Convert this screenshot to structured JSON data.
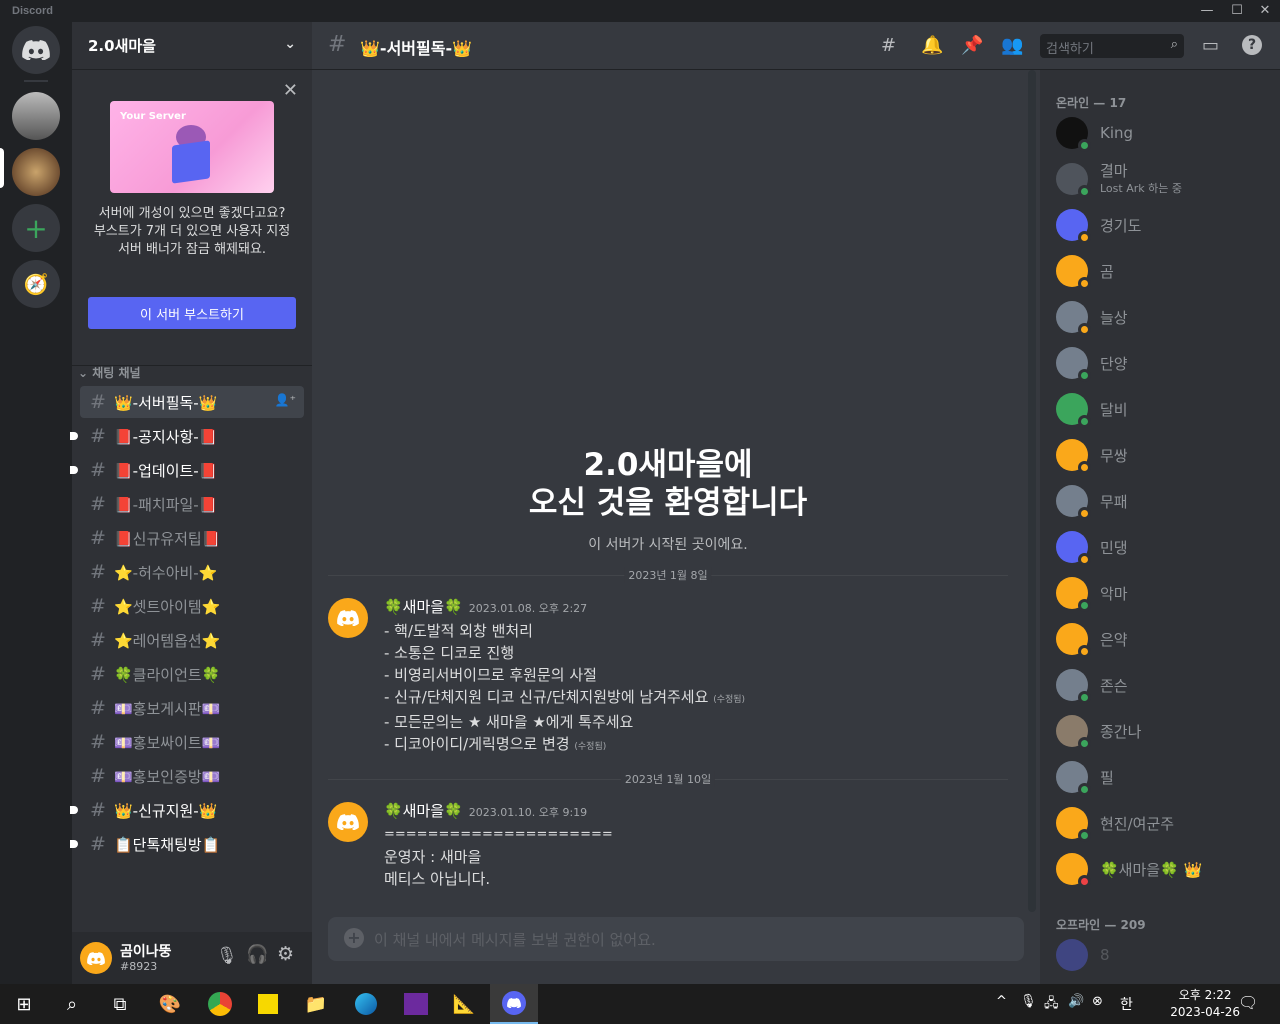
{
  "app": {
    "title": "Discord",
    "window": {
      "minimize": "—",
      "maximize": "☐",
      "close": "✕"
    }
  },
  "server": {
    "name": "2.0새마을"
  },
  "boost_card": {
    "text": "서버에 개성이 있으면 좋겠다고요? 부스트가 7개 더 있으면 사용자 지정 서버 배너가 잠금 해제돼요.",
    "button": "이 서버 부스트하기",
    "art_label": "Your Server"
  },
  "category": "채팅 채널",
  "channels": [
    {
      "label": "👑-서버필독-👑",
      "selected": true,
      "unread": false
    },
    {
      "label": "📕-공지사항-📕",
      "selected": false,
      "unread": true
    },
    {
      "label": "📕-업데이트-📕",
      "selected": false,
      "unread": true
    },
    {
      "label": "📕-패치파일-📕",
      "selected": false,
      "unread": false
    },
    {
      "label": "📕신규유저팁📕",
      "selected": false,
      "unread": false
    },
    {
      "label": "⭐-허수아비-⭐",
      "selected": false,
      "unread": false
    },
    {
      "label": "⭐셋트아이템⭐",
      "selected": false,
      "unread": false
    },
    {
      "label": "⭐레어템옵션⭐",
      "selected": false,
      "unread": false
    },
    {
      "label": "🍀클라이언트🍀",
      "selected": false,
      "unread": false
    },
    {
      "label": "💷홍보게시판💷",
      "selected": false,
      "unread": false
    },
    {
      "label": "💷홍보싸이트💷",
      "selected": false,
      "unread": false
    },
    {
      "label": "💷홍보인증방💷",
      "selected": false,
      "unread": false
    },
    {
      "label": "👑-신규지원-👑",
      "selected": false,
      "unread": true
    },
    {
      "label": "📋단톡채팅방📋",
      "selected": false,
      "unread": true
    }
  ],
  "user": {
    "name": "곰이나뚱",
    "tag": "#8923"
  },
  "header": {
    "channel": "👑-서버필독-👑",
    "search_placeholder": "검색하기"
  },
  "welcome": {
    "line1": "2.0새마을에",
    "line2": "오신 것을 환영합니다",
    "sub": "이 서버가 시작된 곳이에요."
  },
  "messages": [
    {
      "date": "2023년 1월 8일",
      "author": "🍀새마을🍀",
      "timestamp": "2023.01.08. 오후 2:27",
      "lines": [
        "- 핵/도발적 외창 밴처리",
        "- 소통은 디코로 진행",
        "- 비영리서버이므로 후원문의 사절",
        "- 신규/단체지원 디코 신규/단체지원방에  남겨주세요",
        "- 모든문의는 ★ 새마을 ★에게 톡주세요",
        "- 디코아이디/게릭명으로 변경"
      ],
      "edited": "(수정됨)"
    },
    {
      "date": "2023년 1월 10일",
      "author": "🍀새마을🍀",
      "timestamp": "2023.01.10. 오후 9:19",
      "lines": [
        "=====================",
        "운영자 : 새마을",
        "메티스 아닙니다."
      ]
    }
  ],
  "composer": {
    "placeholder": "이 채널 내에서 메시지를 보낼 권한이 없어요."
  },
  "members": {
    "online_header": "온라인 — 17",
    "offline_header": "오프라인 — 209",
    "online": [
      {
        "name": "King",
        "activity": "",
        "color": "#111111",
        "status": "#3ba55c"
      },
      {
        "name": "결마",
        "activity": "Lost Ark 하는 중",
        "color": "#4f545c",
        "status": "#3ba55c"
      },
      {
        "name": "경기도",
        "activity": "",
        "color": "#5865f2",
        "status": "#faa81a"
      },
      {
        "name": "곰",
        "activity": "",
        "color": "#faa81a",
        "status": "#faa81a"
      },
      {
        "name": "늘상",
        "activity": "",
        "color": "#747f8d",
        "status": "#faa81a"
      },
      {
        "name": "단양",
        "activity": "",
        "color": "#747f8d",
        "status": "#3ba55c"
      },
      {
        "name": "달비",
        "activity": "",
        "color": "#3ba55c",
        "status": "#3ba55c"
      },
      {
        "name": "무쌍",
        "activity": "",
        "color": "#faa81a",
        "status": "#faa81a"
      },
      {
        "name": "무패",
        "activity": "",
        "color": "#747f8d",
        "status": "#faa81a"
      },
      {
        "name": "민댕",
        "activity": "",
        "color": "#5865f2",
        "status": "#faa81a"
      },
      {
        "name": "악마",
        "activity": "",
        "color": "#faa81a",
        "status": "#3ba55c"
      },
      {
        "name": "은약",
        "activity": "",
        "color": "#faa81a",
        "status": "#faa81a"
      },
      {
        "name": "존슨",
        "activity": "",
        "color": "#747f8d",
        "status": "#3ba55c"
      },
      {
        "name": "종간나",
        "activity": "",
        "color": "#8a7b6a",
        "status": "#3ba55c"
      },
      {
        "name": "필",
        "activity": "",
        "color": "#747f8d",
        "status": "#3ba55c"
      },
      {
        "name": "현진/여군주",
        "activity": "",
        "color": "#faa81a",
        "status": "#3ba55c"
      },
      {
        "name": "🍀새마을🍀 👑",
        "activity": "",
        "color": "#faa81a",
        "status": "#ed4245"
      }
    ],
    "offline": [
      {
        "name": "8",
        "color": "#5865f2"
      }
    ]
  },
  "taskbar": {
    "time": "오후 2:22",
    "date": "2023-04-26",
    "ime": "한"
  }
}
